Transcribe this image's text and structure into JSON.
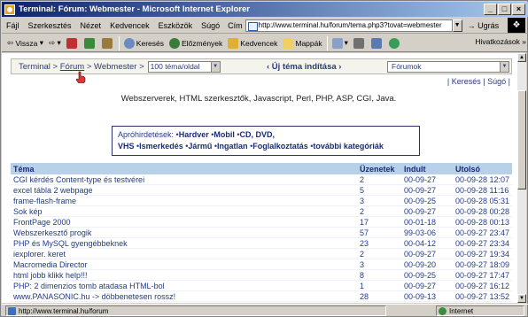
{
  "window": {
    "title": "Terminal: Fórum: Webmester - Microsoft Internet Explorer"
  },
  "menu": [
    "Fájl",
    "Szerkesztés",
    "Nézet",
    "Kedvencek",
    "Eszközök",
    "Súgó"
  ],
  "address": {
    "label": "Cím",
    "url": "http://www.terminal.hu/forum/tema.php3?tovat=webmester",
    "go": "Ugrás"
  },
  "toolbar": {
    "back": "Vissza",
    "search": "Keresés",
    "history": "Előzmények",
    "favorites": "Kedvencek",
    "folders": "Mappák",
    "links": "Hivatkozások »"
  },
  "nav": {
    "crumb1": "Terminal",
    "crumb2": "Fórum",
    "crumb3": "Webmester",
    "gt": ">",
    "per_page": "100 téma/oldal",
    "new_topic": "‹ Új téma indítása ›",
    "forums": "Fórumok"
  },
  "topright": {
    "search": "Keresés",
    "help": "Súgó"
  },
  "description": "Webszerverek, HTML szerkesztők, Javascript, Perl, PHP, ASP, CGI, Java.",
  "ads": {
    "label": "Apróhirdetések:",
    "items": [
      "Hardver",
      "Mobil",
      "CD, DVD,"
    ],
    "items2": [
      "VHS",
      "Ismerkedés",
      "Jármű",
      "Ingatlan",
      "Foglalkoztatás",
      "további kategóriák"
    ]
  },
  "table": {
    "headers": {
      "topic": "Téma",
      "messages": "Üzenetek",
      "started": "Indult",
      "last": "Utolsó"
    },
    "rows": [
      {
        "topic": "CGI kérdés Content-type és testvérei",
        "n": "2",
        "start": "00-09-27",
        "last": "00-09-28 12:07"
      },
      {
        "topic": "excel tábla 2 webpage",
        "n": "5",
        "start": "00-09-27",
        "last": "00-09-28 11:16"
      },
      {
        "topic": "frame-flash-frame",
        "n": "3",
        "start": "00-09-25",
        "last": "00-09-28 05:31"
      },
      {
        "topic": "Sok kép",
        "n": "2",
        "start": "00-09-27",
        "last": "00-09-28 00:28"
      },
      {
        "topic": "FrontPage 2000",
        "n": "17",
        "start": "00-01-18",
        "last": "00-09-28 00:13"
      },
      {
        "topic": "Webszerkesztő progik",
        "n": "57",
        "start": "99-03-06",
        "last": "00-09-27 23:47"
      },
      {
        "topic": "PHP és MySQL gyengébbeknek",
        "n": "23",
        "start": "00-04-12",
        "last": "00-09-27 23:34"
      },
      {
        "topic": "iexplorer. keret",
        "n": "2",
        "start": "00-09-27",
        "last": "00-09-27 19:34"
      },
      {
        "topic": "Macromedia Director",
        "n": "3",
        "start": "00-09-20",
        "last": "00-09-27 18:09"
      },
      {
        "topic": "html jobb klikk help!!!",
        "n": "8",
        "start": "00-09-25",
        "last": "00-09-27 17:47"
      },
      {
        "topic": "PHP: 2 dimenzios tomb atadasa HTML-bol",
        "n": "1",
        "start": "00-09-27",
        "last": "00-09-27 16:12"
      },
      {
        "topic": "www.PANASONIC.hu -> döbbenetesen rossz!",
        "n": "28",
        "start": "00-09-13",
        "last": "00-09-27 13:52"
      }
    ]
  },
  "status": {
    "url": "http://www.terminal.hu/forum",
    "zone": "Internet"
  }
}
